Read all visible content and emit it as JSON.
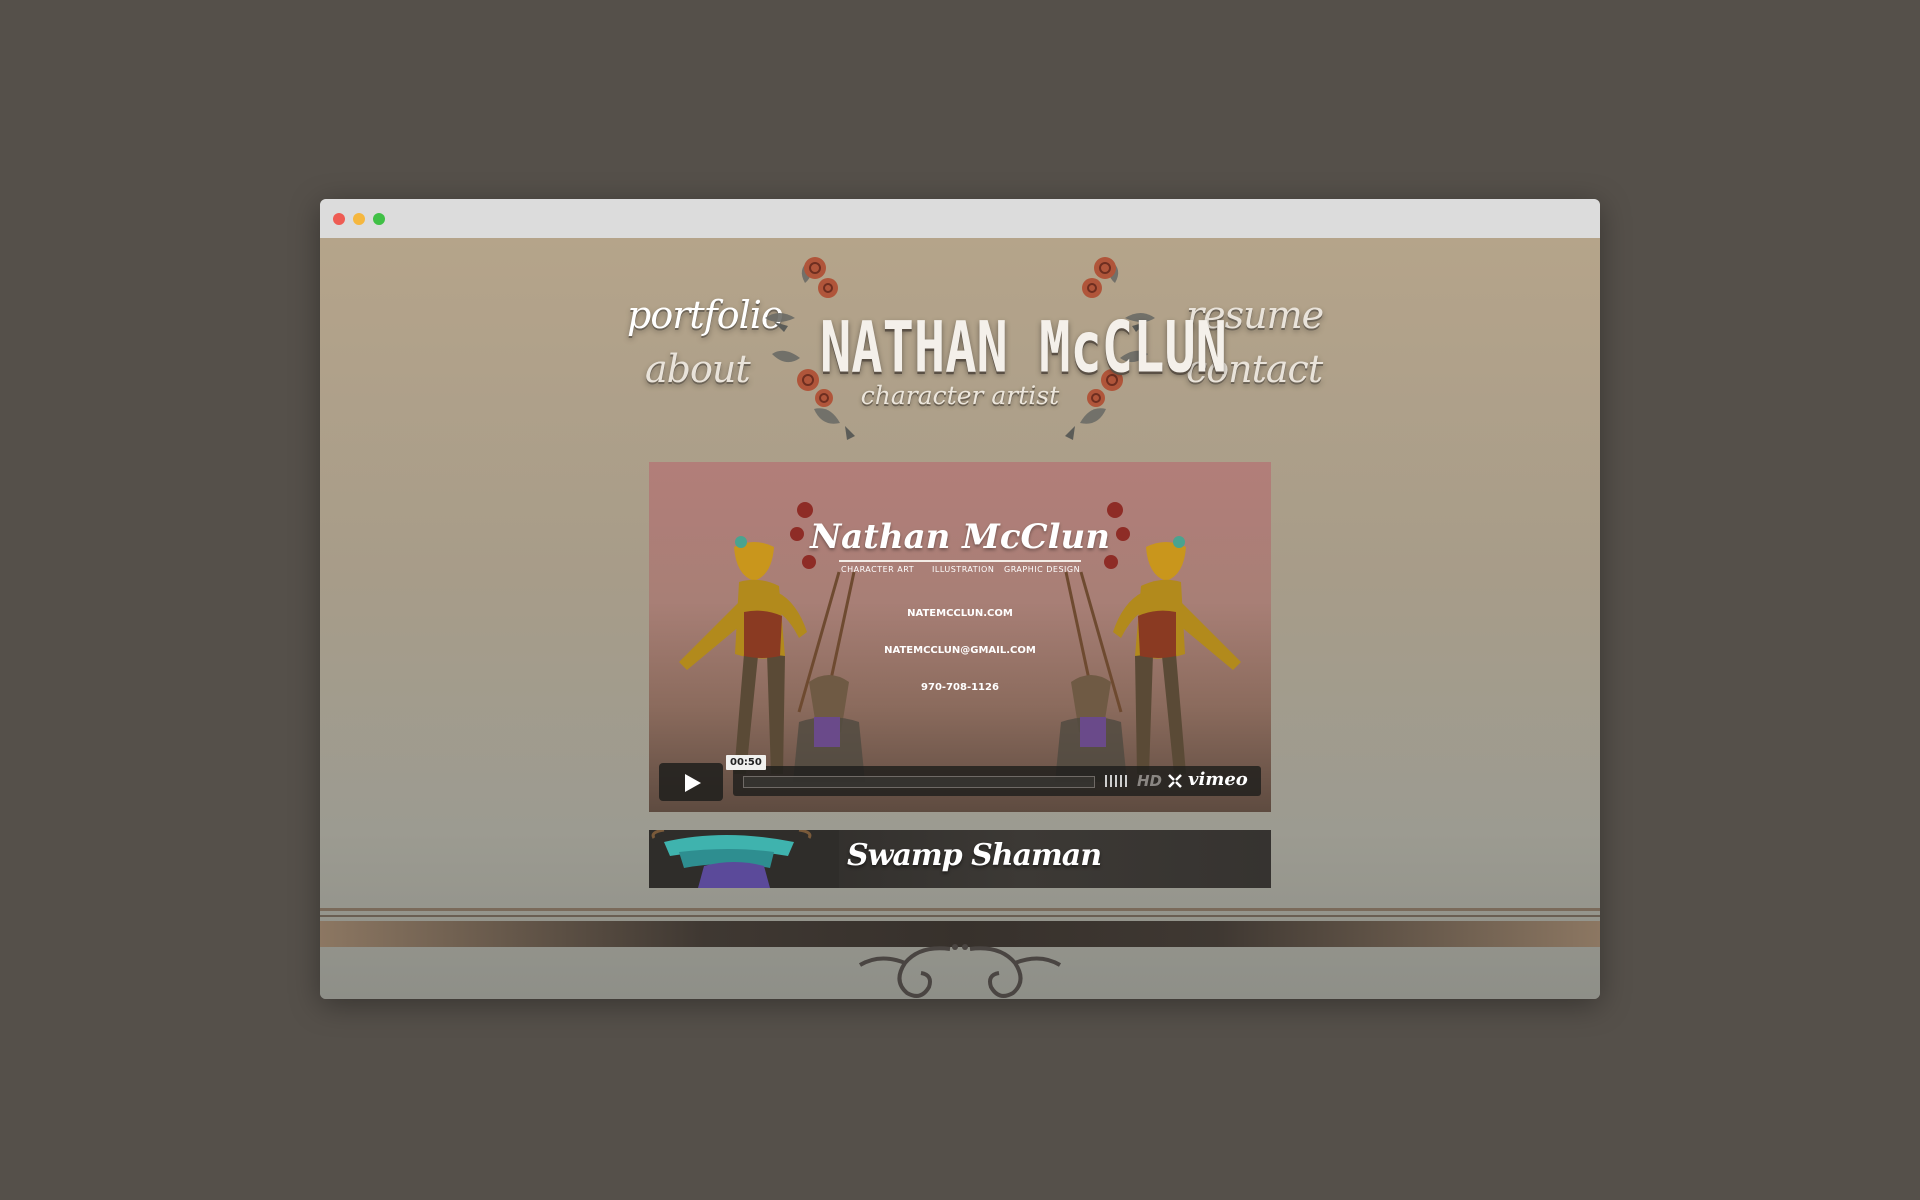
{
  "window": {
    "controls": [
      "close",
      "minimize",
      "maximize"
    ]
  },
  "nav": {
    "portfolio": "portfolio",
    "about": "about",
    "resume": "resume",
    "contact": "contact"
  },
  "logo": {
    "name": "NATHAN McCLUN",
    "tagline": "character artist",
    "decoration_icon": "rose-wreath-icon"
  },
  "video": {
    "card_name": "Nathan McClun",
    "card_subtitles": [
      "CHARACTER ART",
      "ILLUSTRATION",
      "GRAPHIC DESIGN"
    ],
    "website": "NATEMCCLUN.COM",
    "email": "NATEMCCLUN@GMAIL.COM",
    "phone": "970-708-1126",
    "player": {
      "play_icon": "play-icon",
      "timecode": "00:50",
      "hd_label": "HD",
      "fullscreen_icon": "fullscreen-icon",
      "brand": "vimeo",
      "volume_icon": "volume-icon"
    }
  },
  "project": {
    "title": "Swamp Shaman"
  },
  "footer": {
    "ornament_icon": "scroll-ornament-icon"
  },
  "colors": {
    "background": "#55504a",
    "page_top": "#b5a48a",
    "page_bottom": "#8e8f88",
    "text_light": "#f2eee8"
  }
}
